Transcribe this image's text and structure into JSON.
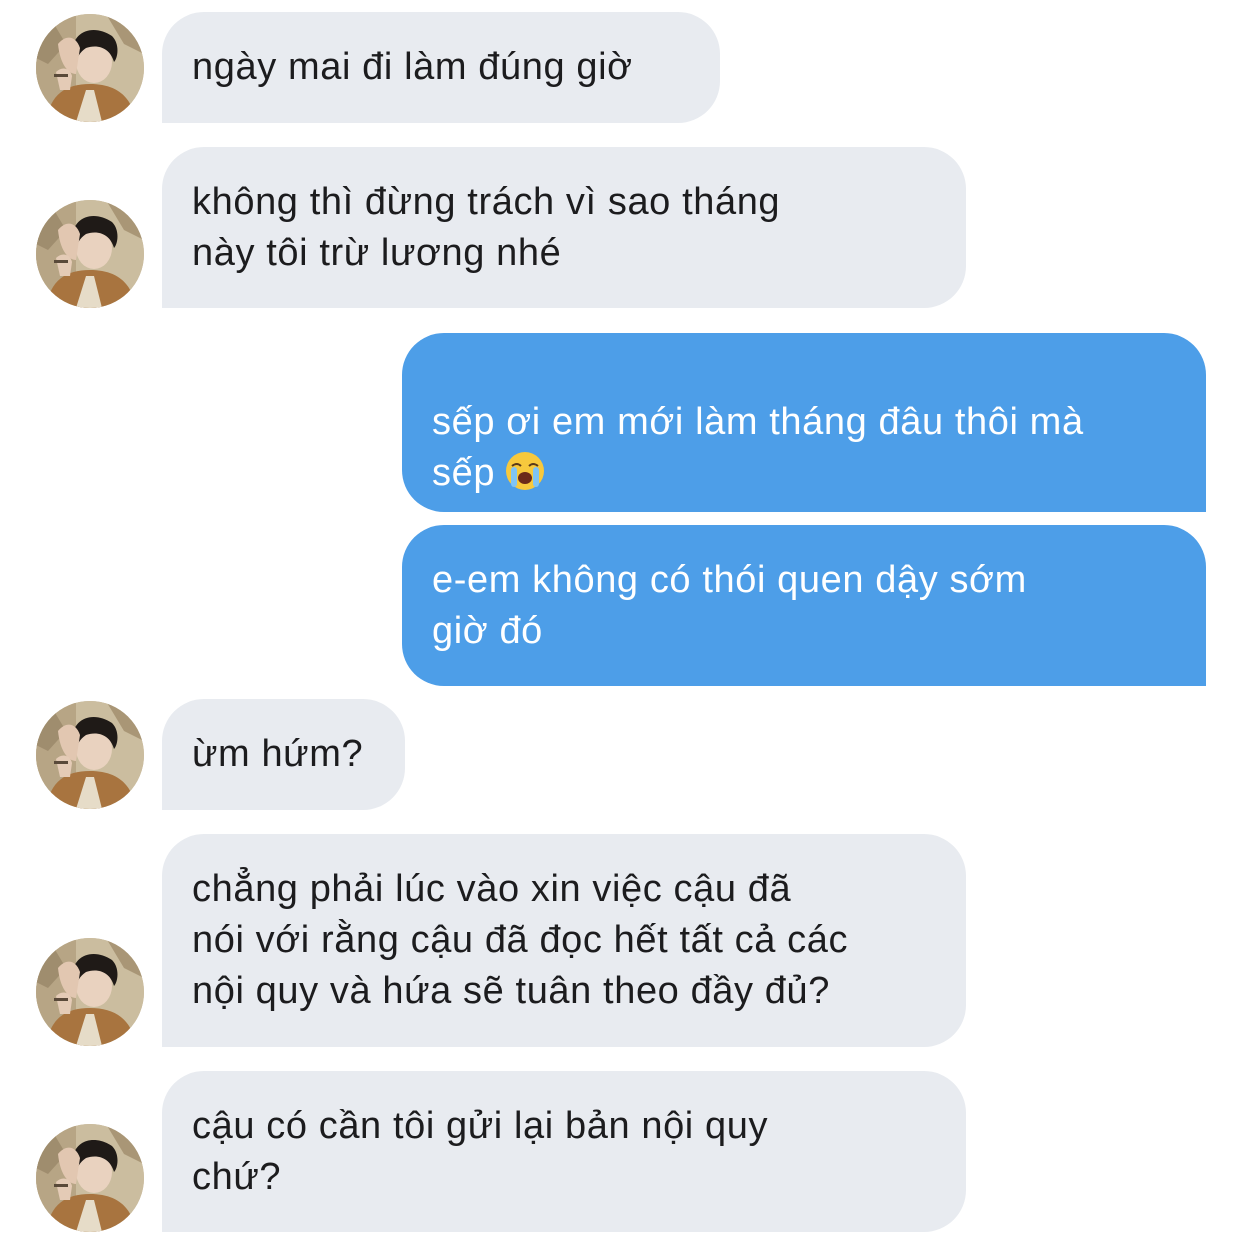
{
  "messages": [
    {
      "side": "incoming",
      "text": "ngày mai đi làm đúng giờ"
    },
    {
      "side": "incoming",
      "text": "không thì đừng trách vì sao tháng\nnày tôi trừ lương nhé"
    },
    {
      "side": "outgoing",
      "text": "sếp ơi em mới làm tháng đâu thôi mà\nsếp",
      "emoji": "loudly-crying-face-emoji"
    },
    {
      "side": "outgoing",
      "text": "e-em không có thói quen dậy sớm\ngiờ đó"
    },
    {
      "side": "incoming",
      "text": "ừm hứm?"
    },
    {
      "side": "incoming",
      "text": "chẳng phải lúc vào xin việc cậu đã\nnói với rằng cậu đã đọc hết tất cả các\nnội quy và hứa sẽ tuân theo đầy đủ?"
    },
    {
      "side": "incoming",
      "text": "cậu có cần tôi gửi lại bản nội quy\nchứ?"
    }
  ],
  "colors": {
    "incoming_bubble": "#e8ebf0",
    "outgoing_bubble": "#4d9ee8",
    "incoming_text": "#1c1c1e",
    "outgoing_text": "#ffffff"
  }
}
